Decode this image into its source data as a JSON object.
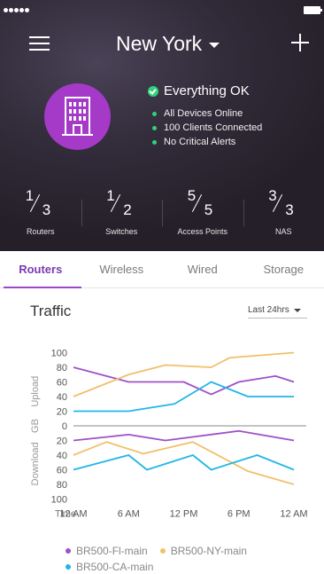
{
  "header": {
    "location": "New York",
    "status_title": "Everything OK",
    "status_items": [
      "All Devices Online",
      "100 Clients Connected",
      "No Critical Alerts"
    ]
  },
  "counts": [
    {
      "label": "Routers",
      "online": "1",
      "total": "3"
    },
    {
      "label": "Switches",
      "online": "1",
      "total": "2"
    },
    {
      "label": "Access Points",
      "online": "5",
      "total": "5"
    },
    {
      "label": "NAS",
      "online": "3",
      "total": "3"
    }
  ],
  "tabs": [
    "Routers",
    "Wireless",
    "Wired",
    "Storage"
  ],
  "active_tab": "Routers",
  "traffic": {
    "title": "Traffic",
    "range": "Last 24hrs"
  },
  "colors": {
    "accent": "#9b47c9",
    "badge": "#a43ac7",
    "ok": "#2fd27a"
  },
  "chart_data": {
    "type": "line",
    "xlabel": "Time",
    "ylabel_center": "GB",
    "upper_label": "Upload",
    "lower_label": "Download",
    "x": [
      "12 AM",
      "",
      "6 AM",
      "",
      "12 PM",
      "",
      "",
      "6 PM",
      "",
      "12 AM"
    ],
    "x_ticks": [
      {
        "index": 0,
        "label": "12 AM"
      },
      {
        "index": 3,
        "label": "6 AM"
      },
      {
        "index": 6,
        "label": "12 PM"
      },
      {
        "index": 9,
        "label": "6 PM"
      },
      {
        "index": 12,
        "label": "12 AM"
      }
    ],
    "upload_ticks": [
      100,
      80,
      60,
      40,
      20,
      0
    ],
    "download_ticks": [
      20,
      40,
      60,
      80,
      100
    ],
    "ylim": [
      0,
      100
    ],
    "series": [
      {
        "name": "BR500-Fl-main",
        "color": "#a050c8",
        "upload": [
          [
            0,
            80
          ],
          [
            3,
            60
          ],
          [
            6,
            60
          ],
          [
            7.5,
            43
          ],
          [
            9,
            60
          ],
          [
            11,
            68
          ],
          [
            12,
            60
          ]
        ],
        "download": [
          [
            0,
            20
          ],
          [
            3,
            12
          ],
          [
            5,
            20
          ],
          [
            9,
            7
          ],
          [
            12,
            20
          ]
        ]
      },
      {
        "name": "BR500-NY-main",
        "color": "#f1c06b",
        "upload": [
          [
            0,
            40
          ],
          [
            3,
            70
          ],
          [
            5,
            83
          ],
          [
            7.5,
            80
          ],
          [
            8.5,
            93
          ],
          [
            12,
            100
          ]
        ],
        "download": [
          [
            0,
            40
          ],
          [
            1.8,
            22
          ],
          [
            3.8,
            38
          ],
          [
            6.5,
            22
          ],
          [
            9.5,
            62
          ],
          [
            12,
            80
          ]
        ]
      },
      {
        "name": "BR500-CA-main",
        "color": "#22b6e6",
        "upload": [
          [
            0,
            20
          ],
          [
            3,
            20
          ],
          [
            5.5,
            30
          ],
          [
            7.5,
            60
          ],
          [
            9.5,
            40
          ],
          [
            12,
            40
          ]
        ],
        "download": [
          [
            0,
            60
          ],
          [
            3,
            40
          ],
          [
            4,
            60
          ],
          [
            6.5,
            40
          ],
          [
            7.5,
            60
          ],
          [
            10,
            40
          ],
          [
            12,
            60
          ]
        ]
      }
    ]
  }
}
